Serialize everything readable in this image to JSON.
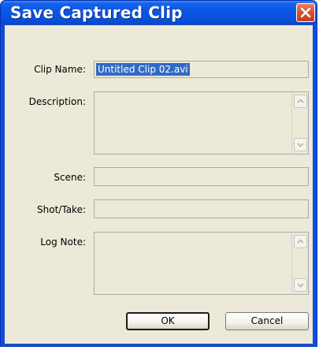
{
  "dialog": {
    "title": "Save Captured Clip"
  },
  "form": {
    "clip_name": {
      "label": "Clip Name:",
      "value": "Untitled Clip 02.avi"
    },
    "description": {
      "label": "Description:",
      "value": ""
    },
    "scene": {
      "label": "Scene:",
      "value": ""
    },
    "shot_take": {
      "label": "Shot/Take:",
      "value": ""
    },
    "log_note": {
      "label": "Log Note:",
      "value": ""
    }
  },
  "buttons": {
    "ok_label": "OK",
    "cancel_label": "Cancel"
  },
  "icons": {
    "close": "close-icon",
    "scroll_up": "scroll-up-arrow-icon",
    "scroll_down": "scroll-down-arrow-icon"
  },
  "colors": {
    "title_bar": "#0a58e6",
    "close_button": "#d9542e",
    "selection": "#316ac5",
    "client_background": "#ece9d8"
  }
}
